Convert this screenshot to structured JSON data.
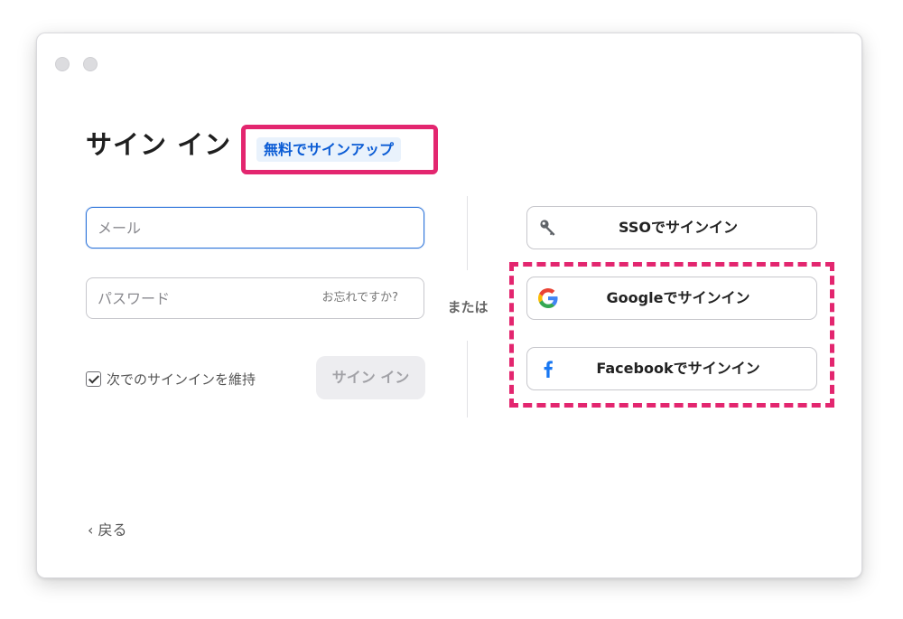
{
  "title": "サイン イン",
  "signup_link": "無料でサインアップ",
  "email": {
    "placeholder": "メール",
    "value": ""
  },
  "password": {
    "placeholder": "パスワード",
    "value": "",
    "forgot_label": "お忘れですか?"
  },
  "remember": {
    "label": "次でのサインインを維持",
    "checked": true
  },
  "signin_button": "サイン イン",
  "or_label": "または",
  "sso_buttons": [
    {
      "label": "SSOでサインイン",
      "icon": "key-icon"
    },
    {
      "label": "Googleでサインイン",
      "icon": "google-icon"
    },
    {
      "label": "Facebookでサインイン",
      "icon": "facebook-icon"
    }
  ],
  "back_label": "戻る",
  "colors": {
    "highlight": "#e3266f",
    "link": "#0b5cd5",
    "link_bg": "#e9f2fc",
    "focus_border": "#2d74da",
    "facebook": "#1877f2"
  }
}
